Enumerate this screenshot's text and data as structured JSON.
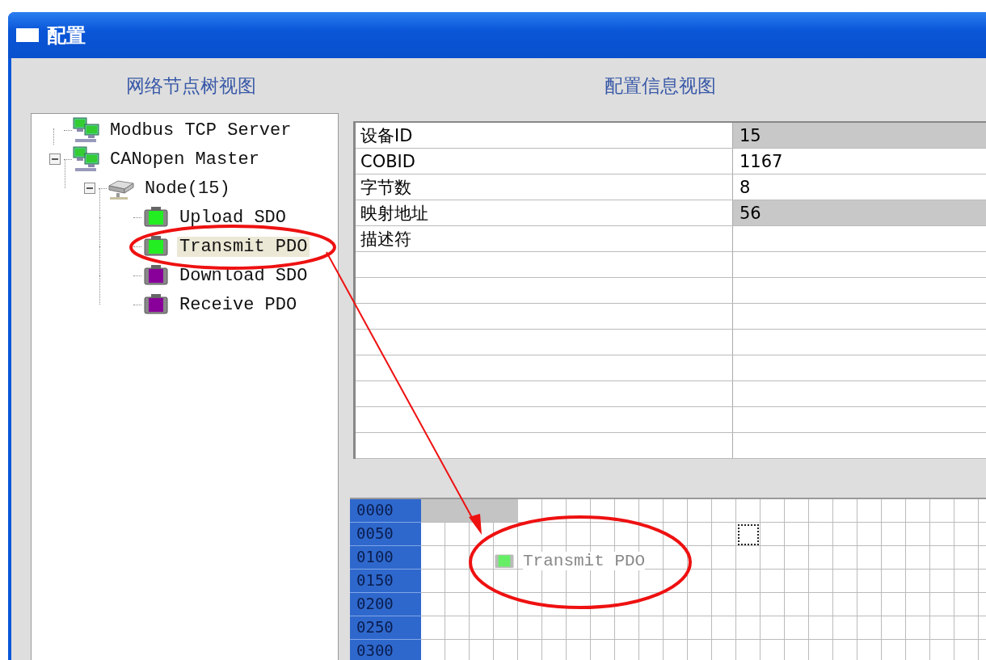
{
  "window": {
    "title": "配置"
  },
  "tree_panel": {
    "heading": "网络节点树视图",
    "items": [
      {
        "label": "Modbus TCP Server",
        "kind": "network",
        "selected": false
      },
      {
        "label": "CANopen Master",
        "kind": "network",
        "expanded": true,
        "selected": false,
        "children": [
          {
            "label": "Node(15)",
            "kind": "device",
            "expanded": true,
            "selected": false,
            "children": [
              {
                "label": "Upload SDO",
                "kind": "pdo",
                "color": "#22ee22",
                "selected": false
              },
              {
                "label": "Transmit PDO",
                "kind": "pdo",
                "color": "#22ee22",
                "selected": true
              },
              {
                "label": "Download SDO",
                "kind": "pdo",
                "color": "#880099",
                "selected": false
              },
              {
                "label": "Receive PDO",
                "kind": "pdo",
                "color": "#880099",
                "selected": false
              }
            ]
          }
        ]
      }
    ]
  },
  "config_panel": {
    "heading": "配置信息视图",
    "rows": [
      {
        "name": "设备ID",
        "value": "15",
        "highlighted": true
      },
      {
        "name": "COBID",
        "value": "1167",
        "highlighted": false
      },
      {
        "name": "字节数",
        "value": "8",
        "highlighted": false
      },
      {
        "name": "映射地址",
        "value": "56",
        "highlighted": true
      },
      {
        "name": "描述符",
        "highlighted": false
      }
    ]
  },
  "memory_map": {
    "rows": [
      {
        "address": "0000",
        "used": true
      },
      {
        "address": "0050",
        "used": false
      },
      {
        "address": "0100",
        "used": false
      },
      {
        "address": "0150",
        "used": false
      },
      {
        "address": "0200",
        "used": false
      },
      {
        "address": "0250",
        "used": false
      },
      {
        "address": "0300",
        "used": false
      }
    ],
    "drag_item": {
      "label": "Transmit PDO",
      "color": "#66ee66"
    }
  }
}
